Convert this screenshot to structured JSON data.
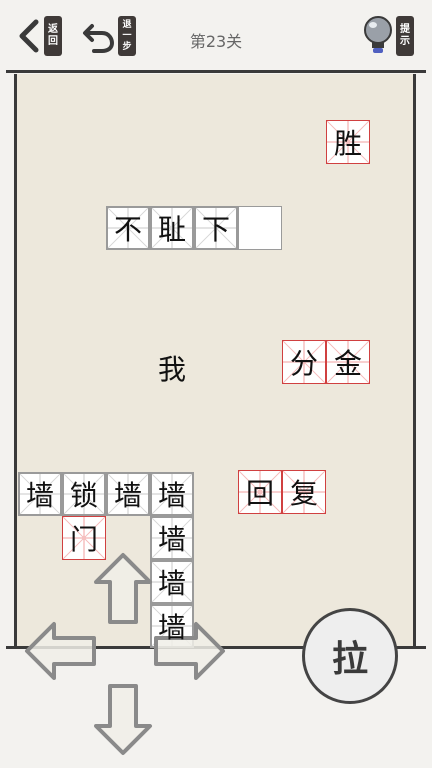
{
  "header": {
    "back_icon": "chevron-left-icon",
    "back_label": [
      "返",
      "回"
    ],
    "undo_icon": "undo-arrow-icon",
    "undo_label": [
      "退",
      "一",
      "步"
    ],
    "level_title": "第23关",
    "hint_icon": "lightbulb-icon",
    "hint_label": [
      "提",
      "示"
    ]
  },
  "board": {
    "tiles": [
      {
        "text": "胜",
        "style": "red"
      },
      {
        "text": "不",
        "style": "gray"
      },
      {
        "text": "耻",
        "style": "gray"
      },
      {
        "text": "下",
        "style": "gray"
      },
      {
        "text": "",
        "style": "blank"
      },
      {
        "text": "分",
        "style": "red"
      },
      {
        "text": "金",
        "style": "red"
      },
      {
        "text": "回",
        "style": "red"
      },
      {
        "text": "复",
        "style": "red"
      },
      {
        "text": "墙",
        "style": "gray"
      },
      {
        "text": "锁",
        "style": "gray"
      },
      {
        "text": "墙",
        "style": "gray"
      },
      {
        "text": "墙",
        "style": "gray"
      },
      {
        "text": "门",
        "style": "red"
      },
      {
        "text": "墙",
        "style": "gray"
      },
      {
        "text": "墙",
        "style": "gray"
      },
      {
        "text": "墙",
        "style": "gray"
      }
    ],
    "player": "我"
  },
  "controls": {
    "up_icon": "arrow-up-icon",
    "down_icon": "arrow-down-icon",
    "left_icon": "arrow-left-icon",
    "right_icon": "arrow-right-icon",
    "pull_label": "拉"
  },
  "colors": {
    "board_bg": "#ede8dc",
    "red_tile_border": "#d04040",
    "seal_bg": "#3f3a38"
  }
}
